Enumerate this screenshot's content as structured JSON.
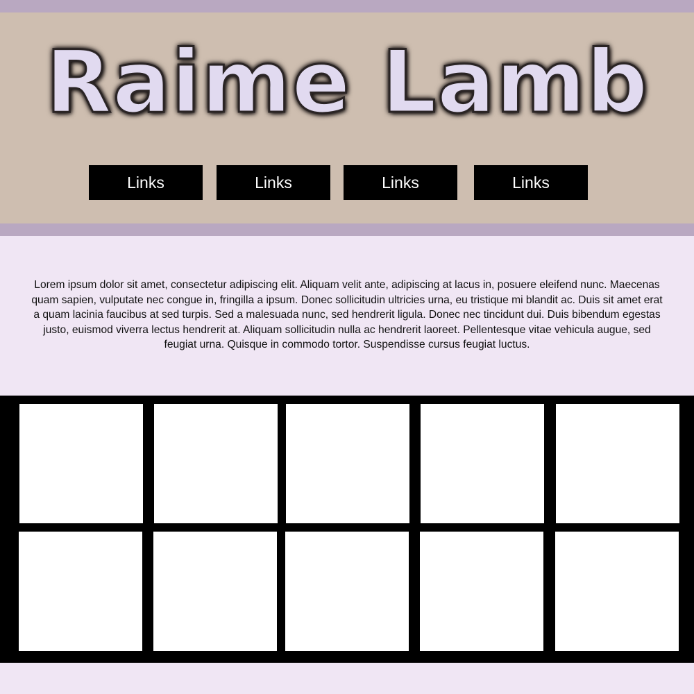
{
  "header": {
    "title": "Raime Lamb",
    "nav": [
      {
        "label": "Links"
      },
      {
        "label": "Links"
      },
      {
        "label": "Links"
      },
      {
        "label": "Links"
      }
    ]
  },
  "intro": {
    "text": "Lorem ipsum dolor sit amet, consectetur adipiscing elit. Aliquam velit ante, adipiscing at lacus in, posuere eleifend nunc. Maecenas quam sapien, vulputate nec congue in, fringilla a ipsum. Donec sollicitudin ultricies urna, eu tristique mi blandit ac. Duis sit amet erat a quam lacinia faucibus at sed turpis. Sed a malesuada nunc, sed hendrerit ligula. Donec nec tincidunt dui. Duis bibendum egestas justo, euismod viverra lectus hendrerit at. Aliquam sollicitudin nulla ac hendrerit laoreet. Pellentesque vitae vehicula augue, sed feugiat urna. Quisque in commodo tortor. Suspendisse cursus feugiat luctus."
  },
  "colors": {
    "header_bg": "#cebeb0",
    "band": "#b9a8c1",
    "page_bg": "#f0e6f4",
    "title_fill": "#e1daf0",
    "nav_bg": "#000000",
    "gallery_bg": "#000000",
    "tile_bg": "#ffffff"
  }
}
